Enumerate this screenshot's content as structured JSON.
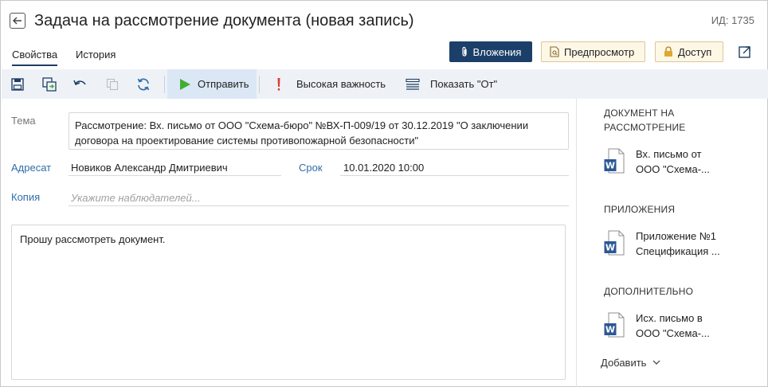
{
  "header": {
    "title": "Задача на рассмотрение документа (новая запись)",
    "record_id": "ИД: 1735"
  },
  "tabs": [
    {
      "label": "Свойства",
      "active": true
    },
    {
      "label": "История",
      "active": false
    }
  ],
  "actions": {
    "attachments_label": "Вложения",
    "preview_label": "Предпросмотр",
    "access_label": "Доступ"
  },
  "toolbar": {
    "send_label": "Отправить",
    "importance_label": "Высокая важность",
    "show_from_label": "Показать \"От\""
  },
  "form": {
    "subject_label": "Тема",
    "subject_value": "Рассмотрение: Вх. письмо от ООО \"Схема-бюро\" №ВХ-П-009/19 от 30.12.2019 \"О заключении договора на проектирование системы противопожарной безопасности\"",
    "addressee_label": "Адресат",
    "addressee_value": "Новиков Александр Дмитриевич",
    "deadline_label": "Срок",
    "deadline_value": "10.01.2020 10:00",
    "copy_label": "Копия",
    "copy_placeholder": "Укажите наблюдателей...",
    "body_text": "Прошу рассмотреть документ."
  },
  "side_panel": {
    "sections": [
      {
        "title_line1": "ДОКУМЕНТ НА",
        "title_line2": "РАССМОТРЕНИЕ",
        "doc_line1": "Вх. письмо от",
        "doc_line2": "ООО \"Схема-..."
      },
      {
        "title_line1": "ПРИЛОЖЕНИЯ",
        "doc_line1": "Приложение №1",
        "doc_line2": "Спецификация ..."
      },
      {
        "title_line1": "ДОПОЛНИТЕЛЬНО",
        "doc_line1": "Исх. письмо в",
        "doc_line2": "ООО \"Схема-..."
      }
    ],
    "add_label": "Добавить"
  },
  "colors": {
    "primary_dark": "#1b3f68",
    "link_blue": "#2f6ea8",
    "send_green": "#3fae34",
    "importance_red": "#e03c31",
    "word_blue": "#2b5797"
  }
}
